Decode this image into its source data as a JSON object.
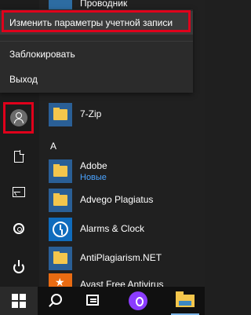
{
  "start_menu": {
    "top_partial_app": {
      "label": "Проводник",
      "icon": "folder-icon"
    },
    "account_menu": {
      "items": [
        {
          "label": "Изменить параметры учетной записи"
        },
        {
          "label": "Заблокировать"
        },
        {
          "label": "Выход"
        }
      ],
      "highlight_color": "#e0001b"
    },
    "rail": {
      "buttons": [
        "user-avatar-icon",
        "documents-icon",
        "pictures-icon",
        "settings-gear-icon",
        "power-icon"
      ]
    },
    "apps": [
      {
        "label": "7-Zip",
        "icon": "folder-icon"
      },
      {
        "group_letter": "A"
      },
      {
        "label": "Adobe",
        "sub": "Новые",
        "icon": "folder-icon"
      },
      {
        "label": "Advego Plagiatus",
        "icon": "folder-icon"
      },
      {
        "label": "Alarms & Clock",
        "icon": "alarm-clock-icon"
      },
      {
        "label": "AntiPlagiarism.NET",
        "icon": "folder-icon"
      },
      {
        "label": "Avast Free Antivirus",
        "icon": "avast-icon"
      }
    ]
  },
  "taskbar": {
    "buttons": [
      "windows-start-icon",
      "search-icon",
      "task-view-icon",
      "alice-assistant-icon",
      "file-explorer-icon"
    ],
    "accent_color": "#7bb3e5"
  }
}
